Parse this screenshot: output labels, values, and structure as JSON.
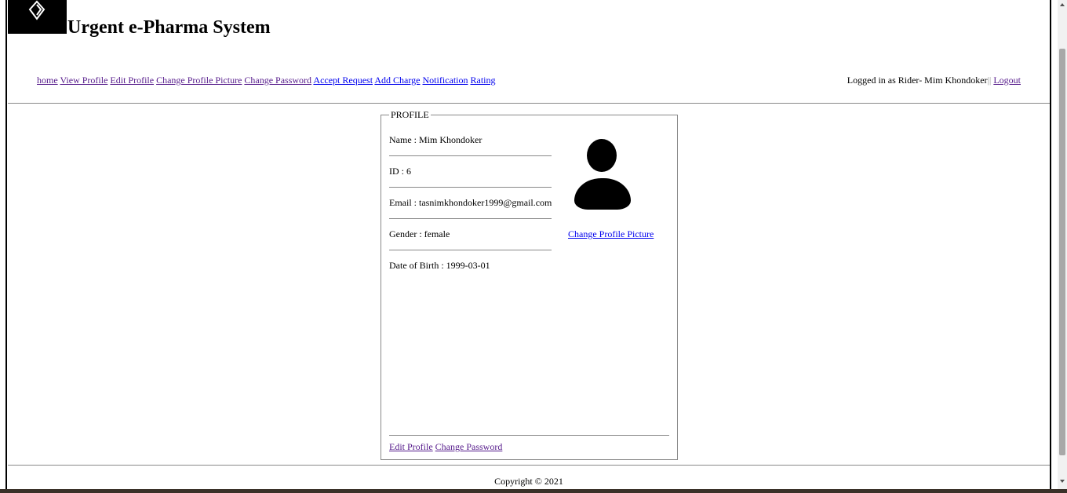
{
  "header": {
    "site_title": "Urgent e-Pharma System",
    "logo_icon": "diamond-logo-icon"
  },
  "nav": {
    "items": [
      {
        "label": "home"
      },
      {
        "label": "View Profile"
      },
      {
        "label": "Edit Profile"
      },
      {
        "label": "Change Profile Picture"
      },
      {
        "label": "Change Password"
      },
      {
        "label": "Accept Request"
      },
      {
        "label": "Add Charge"
      },
      {
        "label": "Notification"
      },
      {
        "label": "Rating"
      }
    ]
  },
  "user_status": {
    "logged_in_text": "Logged in as Rider- Mim Khondoker",
    "separator": "||",
    "logout_label": "Logout"
  },
  "profile": {
    "legend": "PROFILE",
    "fields": [
      {
        "text": "Name : Mim Khondoker"
      },
      {
        "text": "ID : 6"
      },
      {
        "text": "Email : tasnimkhondoker1999@gmail.com"
      },
      {
        "text": "Gender : female"
      },
      {
        "text": "Date of Birth : 1999-03-01"
      }
    ],
    "avatar_icon": "user-silhouette-icon",
    "change_picture_label": "Change Profile Picture",
    "edit_profile_label": "Edit Profile",
    "change_password_label": "Change Password"
  },
  "footer": {
    "copyright": "Copyright © 2021"
  },
  "colors": {
    "link": "#0000ee",
    "visited_link": "#551a8b",
    "rule": "#888888"
  }
}
